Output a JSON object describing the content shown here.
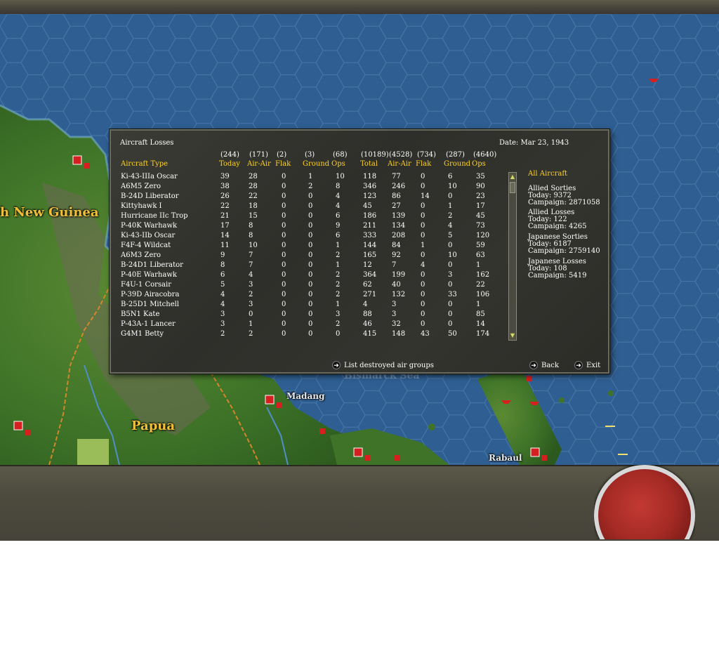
{
  "map": {
    "labels": {
      "new_guinea": "h New Guinea",
      "papua": "Papua",
      "madang": "Madang",
      "rabaul": "Rabaul",
      "bismarck_sea": "Bismarck Sea"
    }
  },
  "dialog": {
    "title": "Aircraft Losses",
    "date": "Date: Mar 23, 1943",
    "column_totals": [
      "(244)",
      "(171)",
      "(2)",
      "(3)",
      "(68)",
      "(10189)",
      "(4528)",
      "(734)",
      "(287)",
      "(4640)"
    ],
    "headers": [
      "Aircraft Type",
      "Today",
      "Air-Air",
      "Flak",
      "Ground",
      "Ops",
      "Total",
      "Air-Air",
      "Flak",
      "Ground",
      "Ops"
    ],
    "rows": [
      [
        "Ki-43-IIIa Oscar",
        "39",
        "28",
        "0",
        "1",
        "10",
        "118",
        "77",
        "0",
        "6",
        "35"
      ],
      [
        "A6M5 Zero",
        "38",
        "28",
        "0",
        "2",
        "8",
        "346",
        "246",
        "0",
        "10",
        "90"
      ],
      [
        "B-24D Liberator",
        "26",
        "22",
        "0",
        "0",
        "4",
        "123",
        "86",
        "14",
        "0",
        "23"
      ],
      [
        "Kittyhawk I",
        "22",
        "18",
        "0",
        "0",
        "4",
        "45",
        "27",
        "0",
        "1",
        "17"
      ],
      [
        "Hurricane IIc Trop",
        "21",
        "15",
        "0",
        "0",
        "6",
        "186",
        "139",
        "0",
        "2",
        "45"
      ],
      [
        "P-40K Warhawk",
        "17",
        "8",
        "0",
        "0",
        "9",
        "211",
        "134",
        "0",
        "4",
        "73"
      ],
      [
        "Ki-43-IIb Oscar",
        "14",
        "8",
        "0",
        "0",
        "6",
        "333",
        "208",
        "0",
        "5",
        "120"
      ],
      [
        "F4F-4 Wildcat",
        "11",
        "10",
        "0",
        "0",
        "1",
        "144",
        "84",
        "1",
        "0",
        "59"
      ],
      [
        "A6M3 Zero",
        "9",
        "7",
        "0",
        "0",
        "2",
        "165",
        "92",
        "0",
        "10",
        "63"
      ],
      [
        "B-24D1 Liberator",
        "8",
        "7",
        "0",
        "0",
        "1",
        "12",
        "7",
        "4",
        "0",
        "1"
      ],
      [
        "P-40E Warhawk",
        "6",
        "4",
        "0",
        "0",
        "2",
        "364",
        "199",
        "0",
        "3",
        "162"
      ],
      [
        "F4U-1 Corsair",
        "5",
        "3",
        "0",
        "0",
        "2",
        "62",
        "40",
        "0",
        "0",
        "22"
      ],
      [
        "P-39D Airacobra",
        "4",
        "2",
        "0",
        "0",
        "2",
        "271",
        "132",
        "0",
        "33",
        "106"
      ],
      [
        "B-25D1 Mitchell",
        "4",
        "3",
        "0",
        "0",
        "1",
        "4",
        "3",
        "0",
        "0",
        "1"
      ],
      [
        "B5N1 Kate",
        "3",
        "0",
        "0",
        "0",
        "3",
        "88",
        "3",
        "0",
        "0",
        "85"
      ],
      [
        "P-43A-1 Lancer",
        "3",
        "1",
        "0",
        "0",
        "2",
        "46",
        "32",
        "0",
        "0",
        "14"
      ],
      [
        "G4M1 Betty",
        "2",
        "2",
        "0",
        "0",
        "0",
        "415",
        "148",
        "43",
        "50",
        "174"
      ]
    ],
    "side": {
      "filter": "All Aircraft",
      "allied_sorties": {
        "label": "Allied Sorties",
        "today": "Today:   9372",
        "campaign": "Campaign: 2871058"
      },
      "allied_losses": {
        "label": "Allied Losses",
        "today": "Today:   122",
        "campaign": "Campaign: 4265"
      },
      "japanese_sorties": {
        "label": "Japanese Sorties",
        "today": "Today:   6187",
        "campaign": "Campaign: 2759140"
      },
      "japanese_losses": {
        "label": "Japanese Losses",
        "today": "Today:   108",
        "campaign": "Campaign: 5419"
      }
    },
    "buttons": {
      "list_destroyed": "List destroyed air groups",
      "back": "Back",
      "exit": "Exit"
    }
  },
  "colors": {
    "header_yellow": "#ffd21f",
    "sea": "#2f5f92",
    "land": "#3f7a2a",
    "base_red": "#d62020"
  }
}
